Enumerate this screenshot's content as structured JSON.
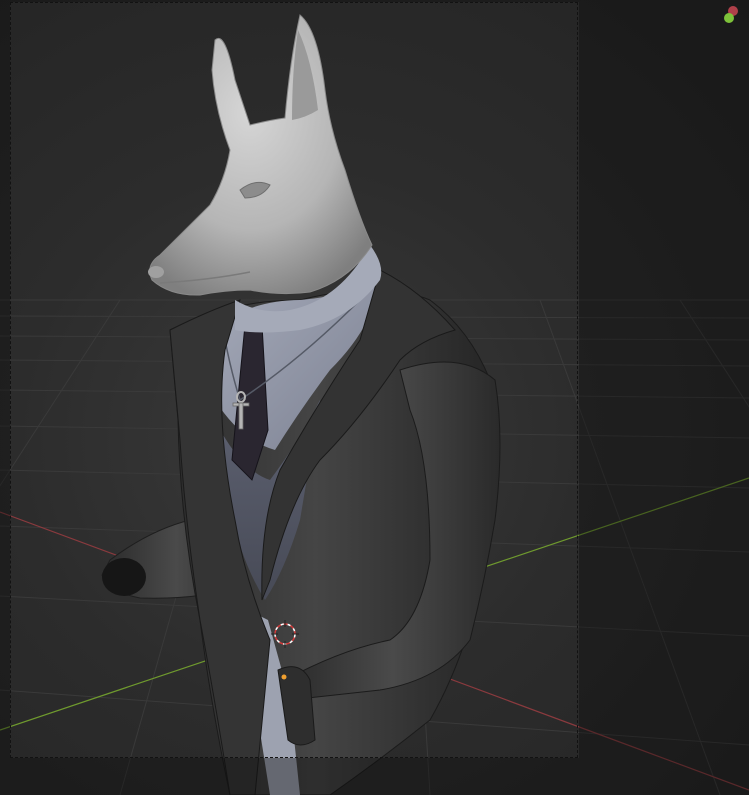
{
  "viewport": {
    "background_color": "#2b2b2b"
  },
  "axes": {
    "x_axis_color": "#8a3a3e",
    "y_axis_color": "#6f9a2e"
  },
  "gizmo": {
    "z_color": "#b0404a",
    "y_color": "#7ec23a"
  },
  "model": {
    "jacket_color": "#3c3c3c",
    "shirt_color": "#9096a6",
    "head_color": "#b9b9b9",
    "tie_color": "#2a2630"
  },
  "cursor_3d": {
    "icon": "3d-cursor-icon"
  },
  "origin": {
    "color": "#f0a030"
  }
}
